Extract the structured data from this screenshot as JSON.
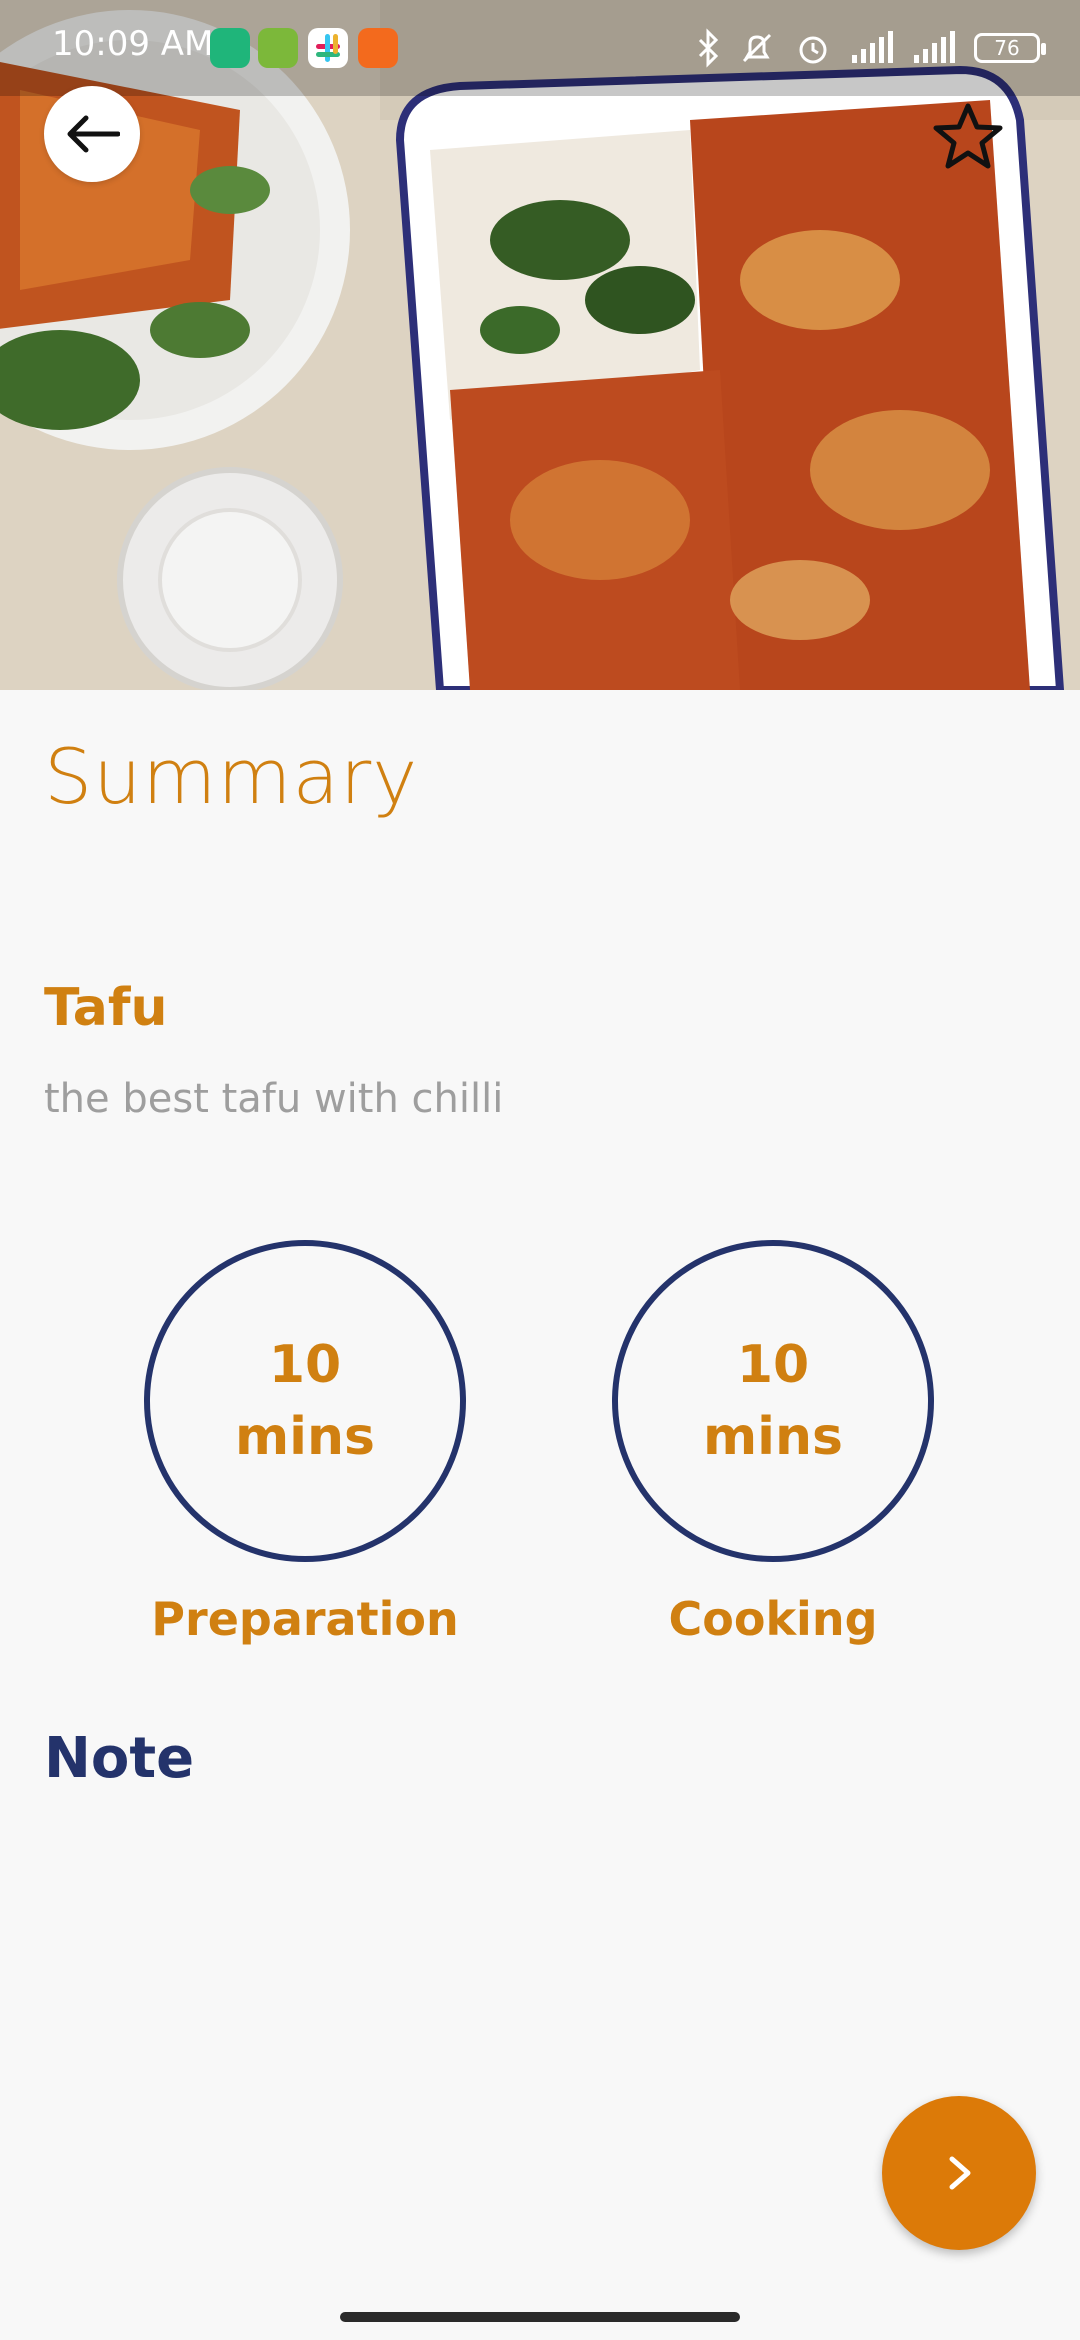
{
  "status_bar": {
    "time": "10:09 AM",
    "battery_level": "76",
    "notification_icons": [
      "shield-app-icon",
      "bug-app-icon",
      "slack-icon",
      "mi-icon"
    ],
    "system_icons": [
      "bluetooth-icon",
      "mute-icon",
      "alarm-icon",
      "signal-icon",
      "signal-icon"
    ]
  },
  "header": {
    "hero_image": "lasagna-food-photo",
    "back_icon": "arrow-left-icon",
    "favorite_icon": "star-outline-icon"
  },
  "page": {
    "title": "Summary",
    "recipe_name": "Tafu",
    "recipe_description": "the best tafu with chilli"
  },
  "times": [
    {
      "value": "10",
      "unit": "mins",
      "label": "Preparation"
    },
    {
      "value": "10",
      "unit": "mins",
      "label": "Cooking"
    }
  ],
  "note": {
    "heading": "Note"
  },
  "fab": {
    "icon": "chevron-right-icon"
  },
  "colors": {
    "accent": "#d08011",
    "fab": "#dc7a08",
    "navy": "#24336b",
    "muted_text": "#9e9e9e",
    "background": "#f8f8f8"
  }
}
